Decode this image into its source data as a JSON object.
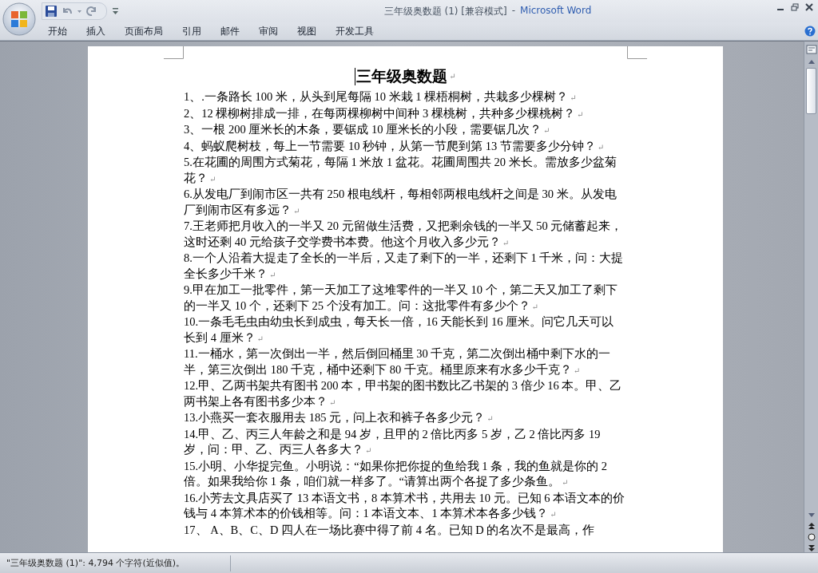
{
  "window": {
    "title": "三年级奥数题 (1) [兼容模式]",
    "separator": "-",
    "app_name": "Microsoft Word"
  },
  "ribbon_tabs": [
    {
      "label": "开始"
    },
    {
      "label": "插入"
    },
    {
      "label": "页面布局"
    },
    {
      "label": "引用"
    },
    {
      "label": "邮件"
    },
    {
      "label": "审阅"
    },
    {
      "label": "视图"
    },
    {
      "label": "开发工具"
    }
  ],
  "document": {
    "title": {
      "text": "三年级奥数题",
      "end_mark": "↵"
    },
    "paragraphs": [
      {
        "text": "1、.一条路长 100 米，从头到尾每隔 10 米栽 1 棵梧桐树，共栽多少棵树？",
        "end_mark": "↵"
      },
      {
        "text": "2、12 棵柳树排成一排，在每两棵柳树中间种 3 棵桃树，共种多少棵桃树？",
        "end_mark": "↵"
      },
      {
        "text": "3、一根 200 厘米长的木条，要锯成 10 厘米长的小段，需要锯几次？",
        "end_mark": "↵"
      },
      {
        "text": "4、蚂蚁爬树枝，每上一节需要 10 秒钟，从第一节爬到第 13 节需要多少分钟？",
        "end_mark": "↵"
      },
      {
        "text": "5.在花圃的周围方式菊花，每隔 1 米放 1 盆花。花圃周围共 20 米长。需放多少盆菊花？",
        "end_mark": "↵"
      },
      {
        "text": "6.从发电厂到闹市区一共有 250 根电线杆，每相邻两根电线杆之间是 30 米。从发电厂到闹市区有多远？",
        "end_mark": "↵"
      },
      {
        "text": "7.王老师把月收入的一半又 20 元留做生活费，又把剩余钱的一半又 50 元储蓄起来，这时还剩 40 元给孩子交学费书本费。他这个月收入多少元？",
        "end_mark": "↵"
      },
      {
        "text": "8.一个人沿着大提走了全长的一半后，又走了剩下的一半，还剩下 1 千米，问：大提全长多少千米？",
        "end_mark": "↵"
      },
      {
        "text": "9.甲在加工一批零件，第一天加工了这堆零件的一半又 10 个，第二天又加工了剩下的一半又 10 个，还剩下 25 个没有加工。问：这批零件有多少个？",
        "end_mark": "↵"
      },
      {
        "text": "10.一条毛毛虫由幼虫长到成虫，每天长一倍，16 天能长到 16 厘米。问它几天可以长到 4 厘米？",
        "end_mark": "↵"
      },
      {
        "text": "11.一桶水，第一次倒出一半，然后倒回桶里 30 千克，第二次倒出桶中剩下水的一半，第三次倒出 180 千克，桶中还剩下 80 千克。桶里原来有水多少千克？",
        "end_mark": "↵"
      },
      {
        "text": "12.甲、乙两书架共有图书 200 本，甲书架的图书数比乙书架的 3 倍少 16 本。甲、乙两书架上各有图书多少本？",
        "end_mark": "↵"
      },
      {
        "text": "13.小燕买一套衣服用去 185 元，问上衣和裤子各多少元？",
        "end_mark": "↵"
      },
      {
        "text": "14.甲、乙、丙三人年龄之和是 94 岁，且甲的 2 倍比丙多 5 岁，乙 2 倍比丙多 19 岁，问：甲、乙、丙三人各多大？",
        "end_mark": "↵"
      },
      {
        "text": "15.小明、小华捉完鱼。小明说：“如果你把你捉的鱼给我 1 条，我的鱼就是你的 2 倍。如果我给你 1 条，咱们就一样多了。“请算出两个各捉了多少条鱼。",
        "end_mark": "↵"
      },
      {
        "text": "16.小芳去文具店买了 13 本语文书，8 本算术书，共用去 10 元。已知 6 本语文本的价钱与 4 本算术本的价钱相等。问：1 本语文本、1 本算术本各多少钱？",
        "end_mark": "↵"
      },
      {
        "text": "17、 A、B、C、D 四人在一场比赛中得了前 4 名。已知 D 的名次不是最高，作"
      }
    ]
  },
  "status_bar": {
    "text": "\"三年级奥数题 (1)\": 4,794 个字符(近似值)。"
  }
}
